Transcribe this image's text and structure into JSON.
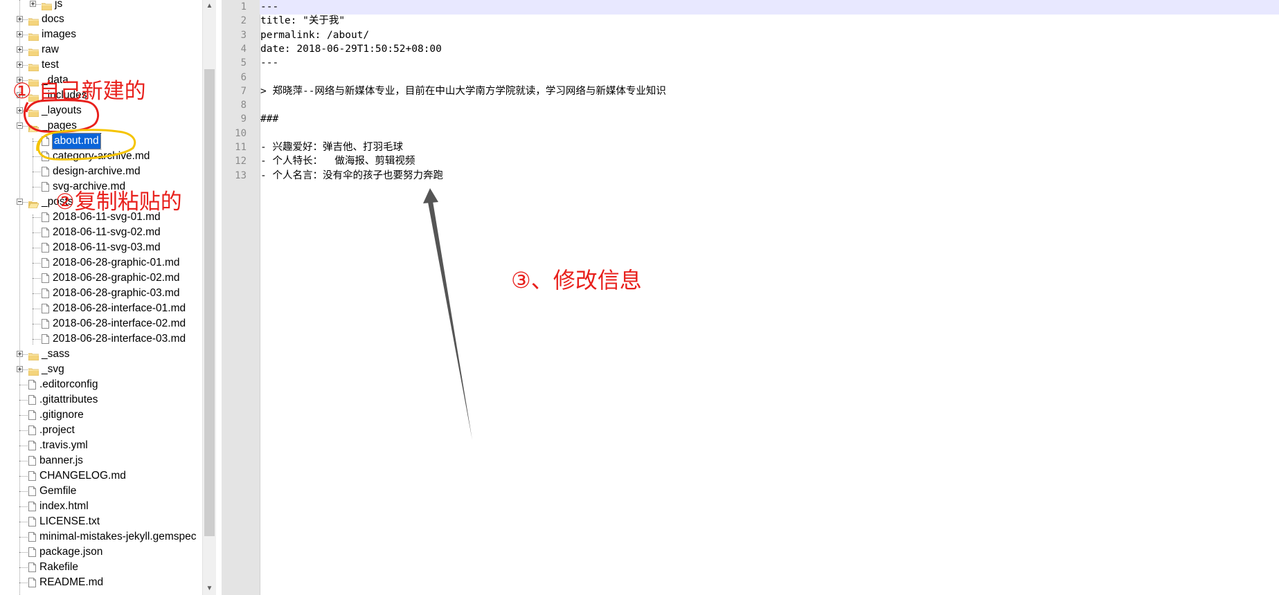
{
  "tree": {
    "items": [
      {
        "label": "js",
        "type": "folder",
        "depth": 2,
        "expander": "plus"
      },
      {
        "label": "docs",
        "type": "folder",
        "depth": 1,
        "expander": "plus"
      },
      {
        "label": "images",
        "type": "folder",
        "depth": 1,
        "expander": "plus"
      },
      {
        "label": "raw",
        "type": "folder",
        "depth": 1,
        "expander": "plus"
      },
      {
        "label": "test",
        "type": "folder",
        "depth": 1,
        "expander": "plus"
      },
      {
        "label": "_data",
        "type": "folder",
        "depth": 1,
        "expander": "plus"
      },
      {
        "label": "_includes",
        "type": "folder",
        "depth": 1,
        "expander": "plus"
      },
      {
        "label": "_layouts",
        "type": "folder",
        "depth": 1,
        "expander": "plus"
      },
      {
        "label": "_pages",
        "type": "folder-open",
        "depth": 1,
        "expander": "minus"
      },
      {
        "label": "about.md",
        "type": "file",
        "depth": 2,
        "selected": true
      },
      {
        "label": "category-archive.md",
        "type": "file",
        "depth": 2
      },
      {
        "label": "design-archive.md",
        "type": "file",
        "depth": 2
      },
      {
        "label": "svg-archive.md",
        "type": "file",
        "depth": 2
      },
      {
        "label": "_posts",
        "type": "folder-open",
        "depth": 1,
        "expander": "minus"
      },
      {
        "label": "2018-06-11-svg-01.md",
        "type": "file",
        "depth": 2
      },
      {
        "label": "2018-06-11-svg-02.md",
        "type": "file",
        "depth": 2
      },
      {
        "label": "2018-06-11-svg-03.md",
        "type": "file",
        "depth": 2
      },
      {
        "label": "2018-06-28-graphic-01.md",
        "type": "file",
        "depth": 2
      },
      {
        "label": "2018-06-28-graphic-02.md",
        "type": "file",
        "depth": 2
      },
      {
        "label": "2018-06-28-graphic-03.md",
        "type": "file",
        "depth": 2
      },
      {
        "label": "2018-06-28-interface-01.md",
        "type": "file",
        "depth": 2
      },
      {
        "label": "2018-06-28-interface-02.md",
        "type": "file",
        "depth": 2
      },
      {
        "label": "2018-06-28-interface-03.md",
        "type": "file",
        "depth": 2
      },
      {
        "label": "_sass",
        "type": "folder",
        "depth": 1,
        "expander": "plus"
      },
      {
        "label": "_svg",
        "type": "folder",
        "depth": 1,
        "expander": "plus"
      },
      {
        "label": ".editorconfig",
        "type": "file",
        "depth": 1
      },
      {
        "label": ".gitattributes",
        "type": "file",
        "depth": 1
      },
      {
        "label": ".gitignore",
        "type": "file",
        "depth": 1
      },
      {
        "label": ".project",
        "type": "file",
        "depth": 1
      },
      {
        "label": ".travis.yml",
        "type": "file",
        "depth": 1
      },
      {
        "label": "banner.js",
        "type": "file",
        "depth": 1
      },
      {
        "label": "CHANGELOG.md",
        "type": "file",
        "depth": 1
      },
      {
        "label": "Gemfile",
        "type": "file",
        "depth": 1
      },
      {
        "label": "index.html",
        "type": "file",
        "depth": 1
      },
      {
        "label": "LICENSE.txt",
        "type": "file",
        "depth": 1
      },
      {
        "label": "minimal-mistakes-jekyll.gemspec",
        "type": "file",
        "depth": 1
      },
      {
        "label": "package.json",
        "type": "file",
        "depth": 1
      },
      {
        "label": "Rakefile",
        "type": "file",
        "depth": 1
      },
      {
        "label": "README.md",
        "type": "file",
        "depth": 1
      }
    ]
  },
  "scrollbar": {
    "up_icon": "▲",
    "down_icon": "▼"
  },
  "editor": {
    "lines": [
      {
        "num": "1",
        "text": "---"
      },
      {
        "num": "2",
        "text": "title: \"关于我\""
      },
      {
        "num": "3",
        "text": "permalink: /about/"
      },
      {
        "num": "4",
        "text": "date: 2018-06-29T1:50:52+08:00"
      },
      {
        "num": "5",
        "text": "---"
      },
      {
        "num": "6",
        "text": ""
      },
      {
        "num": "7",
        "text": "> 郑晓萍--网络与新媒体专业，目前在中山大学南方学院就读，学习网络与新媒体专业知识"
      },
      {
        "num": "8",
        "text": ""
      },
      {
        "num": "9",
        "text": "###"
      },
      {
        "num": "10",
        "text": ""
      },
      {
        "num": "11",
        "text": "- 兴趣爱好：弹吉他、打羽毛球"
      },
      {
        "num": "12",
        "text": "- 个人特长：  做海报、剪辑视频"
      },
      {
        "num": "13",
        "text": "- 个人名言：没有伞的孩子也要努力奔跑"
      }
    ]
  },
  "annotations": {
    "a1": "① 自己新建的",
    "a2": "②复制粘贴的",
    "a3": "③、修改信息",
    "color": "#e8201c",
    "highlight_color": "#f5c400",
    "arrow_color": "#555555"
  }
}
